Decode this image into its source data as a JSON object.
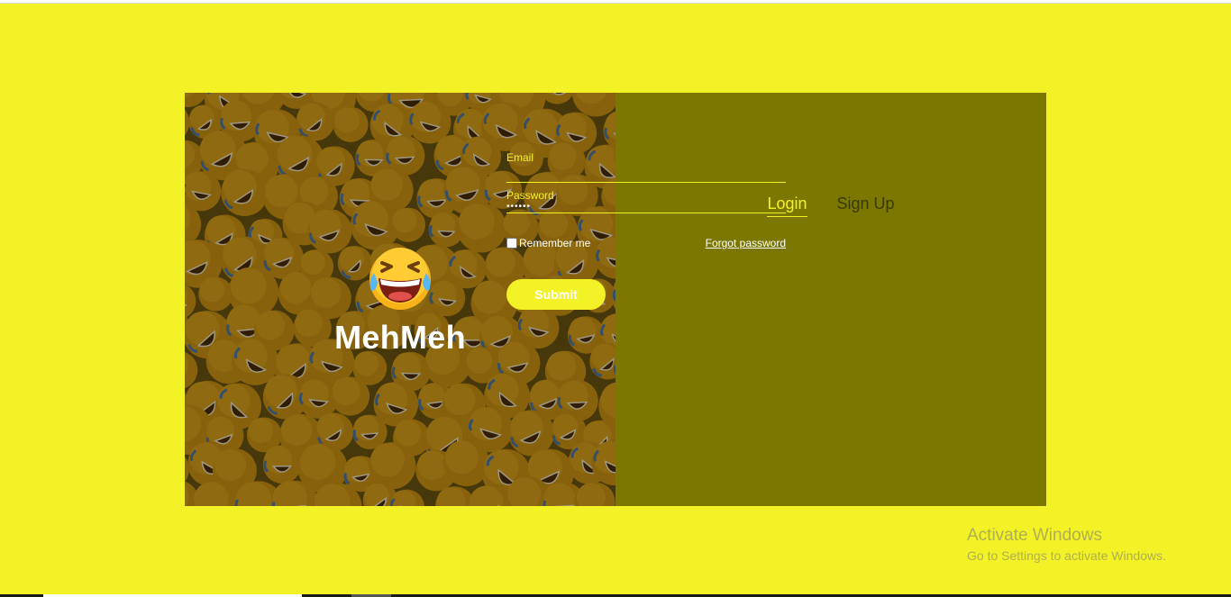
{
  "brand": {
    "name": "MehMeh",
    "emoji_icon": "face-with-tears-of-joy-icon"
  },
  "tabs": [
    {
      "label": "Login",
      "active": true
    },
    {
      "label": "Sign Up",
      "active": false
    }
  ],
  "form": {
    "email": {
      "label": "Email",
      "value": ""
    },
    "password": {
      "label": "Password",
      "value": "••••••"
    },
    "remember": {
      "label": "Remember me",
      "checked": false
    },
    "forgot_label": "Forgot password",
    "submit_label": "Submit"
  },
  "watermark": {
    "title": "Activate Windows",
    "subtitle": "Go to Settings to activate Windows."
  },
  "colors": {
    "page_background": "#f2f226",
    "panel_background": "#7b7700",
    "accent": "#f2f226",
    "muted_tab": "#3b3a00"
  }
}
